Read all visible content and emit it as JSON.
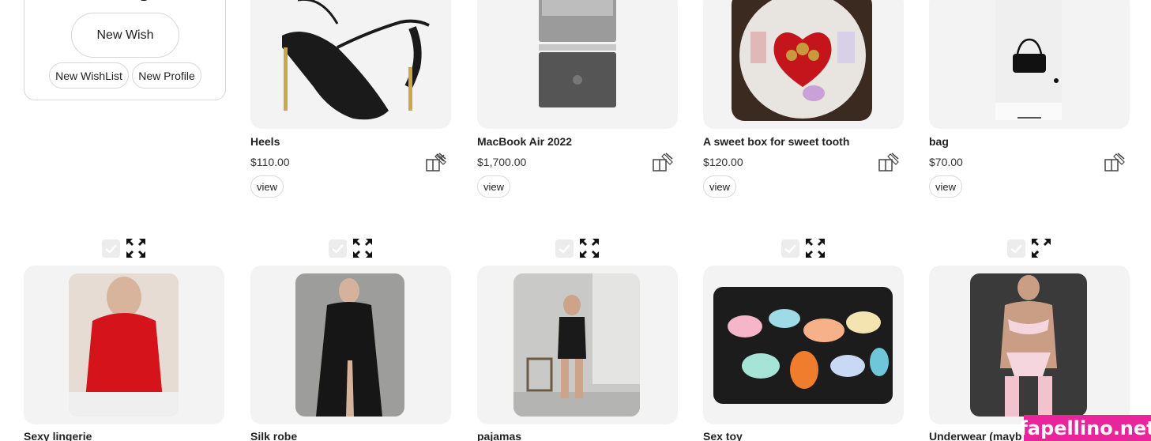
{
  "sidebar": {
    "new_wish_label": "New Wish",
    "new_wishlist_label": "New WishList",
    "new_profile_label": "New Profile"
  },
  "row1": [
    {
      "name": "Heels",
      "price": "$110.00",
      "view_label": "view",
      "icon": "gift-icon"
    },
    {
      "name": "MacBook Air 2022",
      "price": "$1,700.00",
      "view_label": "view",
      "icon": "gift-icon"
    },
    {
      "name": "A sweet box for sweet tooth",
      "price": "$120.00",
      "view_label": "view",
      "icon": "gift-icon"
    },
    {
      "name": "bag",
      "price": "$70.00",
      "view_label": "view",
      "icon": "gift-icon"
    }
  ],
  "row2": [
    {
      "name": "Sexy lingerie"
    },
    {
      "name": "Silk robe"
    },
    {
      "name": "pajamas"
    },
    {
      "name": "Sex toy"
    },
    {
      "name": "Underwear (mayb"
    }
  ],
  "row2_icons": [
    "checkbox-icon",
    "expand-icon"
  ],
  "watermark": "fapellino.net",
  "colors": {
    "accent_watermark": "#e8259a",
    "card_bg": "#f3f3f3",
    "border": "#d6d6d6"
  }
}
